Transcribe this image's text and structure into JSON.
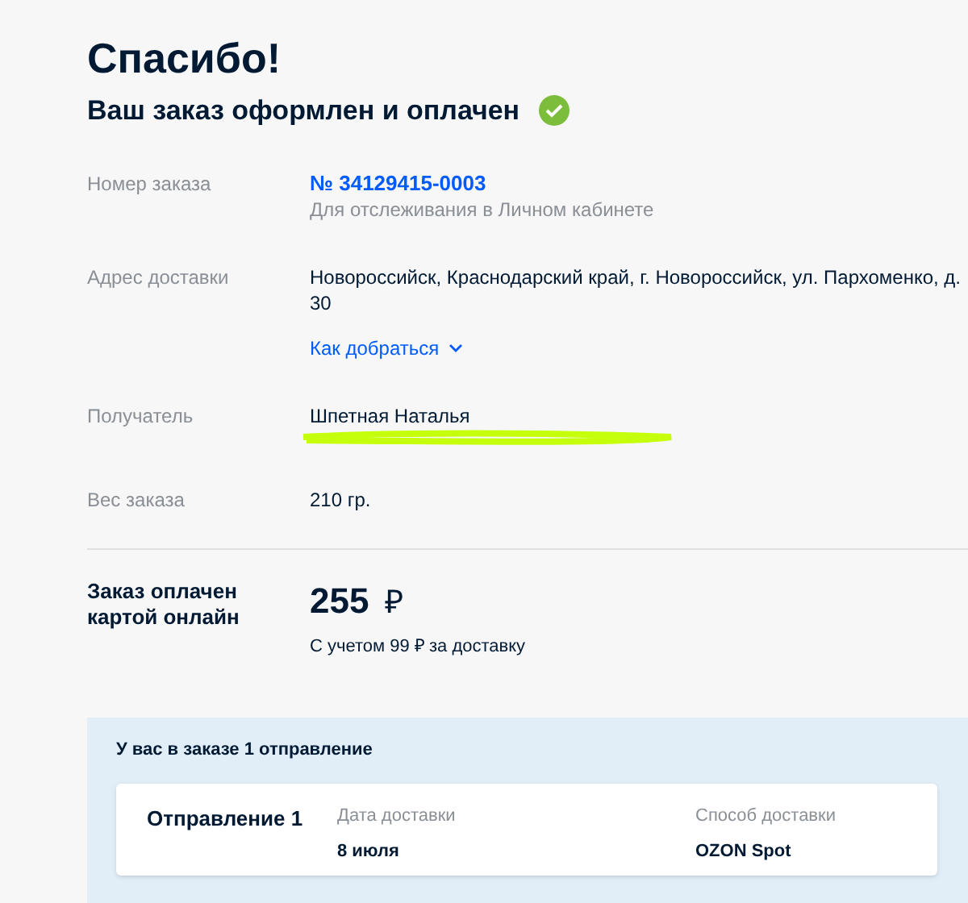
{
  "title": "Спасибо!",
  "subtitle": {
    "text": "Ваш заказ оформлен и оплачен",
    "confirmed": true
  },
  "details": [
    {
      "kind": "order",
      "label": "Номер заказа",
      "value": "№ 34129415-0003",
      "note": "Для отслеживания в Личном кабинете"
    },
    {
      "kind": "address",
      "label": "Адрес доставки",
      "value": "Новороссийск, Краснодарский край, г. Новороссийск, ул. Пархоменко, д. 30",
      "link": "Как добраться"
    },
    {
      "kind": "recipient",
      "label": "Получатель",
      "value": "Шпетная Наталья"
    },
    {
      "kind": "plain",
      "label": "Вес заказа",
      "value": "210 гр."
    }
  ],
  "payment": {
    "label": "Заказ оплачен картой онлайн",
    "amount": "255",
    "currency": "₽",
    "note": "С учетом 99  ₽ за доставку"
  },
  "shipments": {
    "heading": "У вас в заказе 1 отправление",
    "items": [
      {
        "name": "Отправление 1",
        "date_label": "Дата доставки",
        "date": "8 июля",
        "method_label": "Способ доставки",
        "method": "OZON Spot"
      }
    ]
  }
}
